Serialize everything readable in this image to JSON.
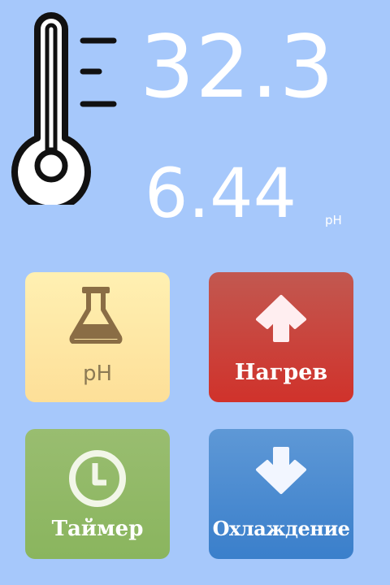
{
  "readings": {
    "temperature": "32.3",
    "ph": "6.44",
    "ph_unit": "pH"
  },
  "icons": {
    "thermometer": "thermometer-icon",
    "flask": "flask-icon",
    "arrow_up": "arrow-up-icon",
    "clock": "clock-icon",
    "arrow_down": "arrow-down-icon"
  },
  "buttons": {
    "ph": {
      "label": "pH",
      "color": "#fde7a4"
    },
    "heat": {
      "label": "Нагрев",
      "color": "#cc3c33"
    },
    "timer": {
      "label": "Таймер",
      "color": "#92b967"
    },
    "cool": {
      "label": "Охлаждение",
      "color": "#4a88cf"
    }
  },
  "colors": {
    "background": "#a6c8fb",
    "text": "#ffffff"
  }
}
